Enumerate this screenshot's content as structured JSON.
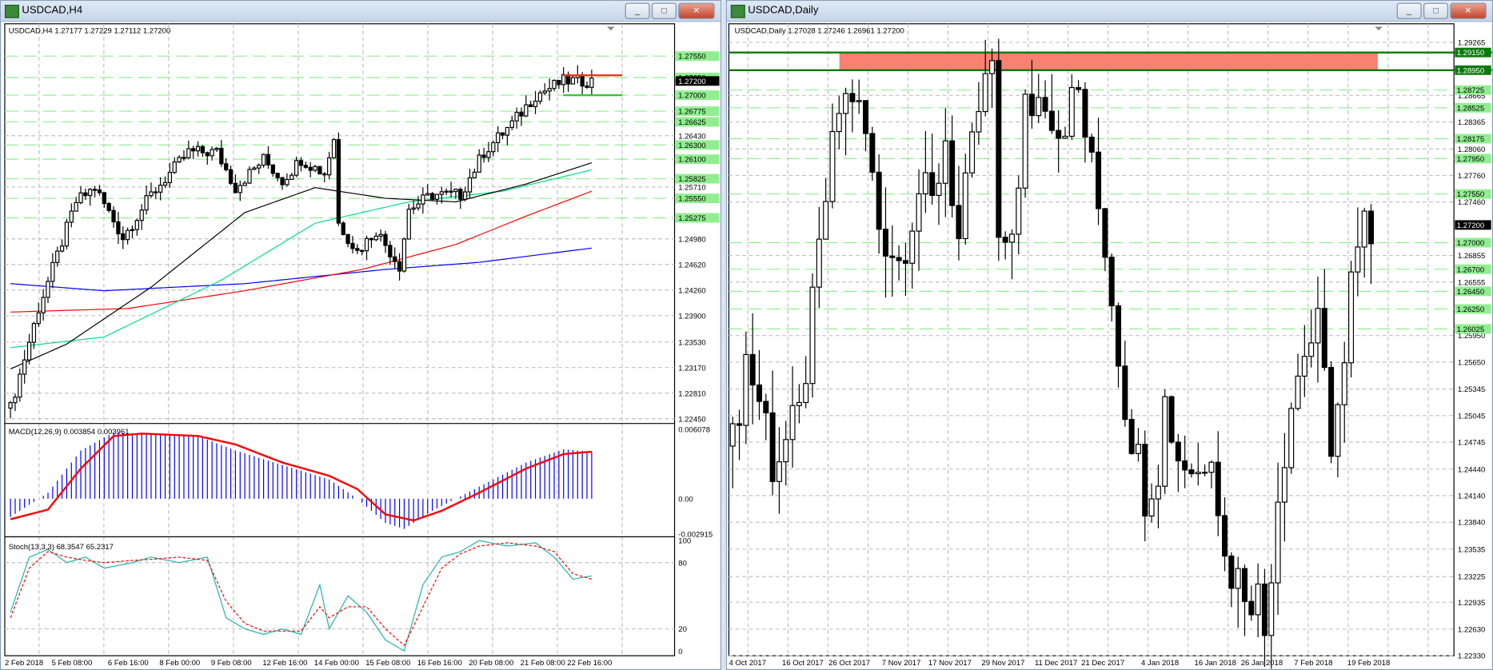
{
  "left": {
    "title": "USDCAD,H4",
    "info": "USDCAD,H4  1.27177 1.27229 1.27112 1.27200",
    "price_range": [
      1.2245,
      1.2775
    ],
    "candle_count": 125,
    "price_keys": [
      [
        0,
        1.226
      ],
      [
        6,
        1.24
      ],
      [
        14,
        1.255
      ],
      [
        18,
        1.257
      ],
      [
        24,
        1.25
      ],
      [
        30,
        1.256
      ],
      [
        38,
        1.262
      ],
      [
        44,
        1.262
      ],
      [
        48,
        1.257
      ],
      [
        54,
        1.261
      ],
      [
        58,
        1.258
      ],
      [
        62,
        1.261
      ],
      [
        67,
        1.259
      ],
      [
        69,
        1.264
      ],
      [
        70,
        1.252
      ],
      [
        74,
        1.248
      ],
      [
        78,
        1.251
      ],
      [
        83,
        1.246
      ],
      [
        85,
        1.254
      ],
      [
        90,
        1.256
      ],
      [
        96,
        1.256
      ],
      [
        101,
        1.262
      ],
      [
        107,
        1.266
      ],
      [
        112,
        1.27
      ],
      [
        118,
        1.272
      ],
      [
        124,
        1.272
      ]
    ],
    "ma_black": [
      [
        0,
        1.2315
      ],
      [
        12,
        1.235
      ],
      [
        30,
        1.243
      ],
      [
        50,
        1.2535
      ],
      [
        65,
        1.257
      ],
      [
        80,
        1.2555
      ],
      [
        95,
        1.255
      ],
      [
        110,
        1.2575
      ],
      [
        124,
        1.2605
      ]
    ],
    "ma_green": [
      [
        0,
        1.2345
      ],
      [
        20,
        1.236
      ],
      [
        45,
        1.244
      ],
      [
        65,
        1.252
      ],
      [
        85,
        1.255
      ],
      [
        105,
        1.2565
      ],
      [
        124,
        1.2595
      ]
    ],
    "ma_red": [
      [
        0,
        1.2395
      ],
      [
        25,
        1.24
      ],
      [
        50,
        1.2425
      ],
      [
        75,
        1.2455
      ],
      [
        95,
        1.249
      ],
      [
        110,
        1.253
      ],
      [
        124,
        1.2565
      ]
    ],
    "ma_blue": [
      [
        0,
        1.2435
      ],
      [
        20,
        1.2425
      ],
      [
        50,
        1.2435
      ],
      [
        80,
        1.2455
      ],
      [
        100,
        1.2465
      ],
      [
        124,
        1.2485
      ]
    ],
    "levels": [
      {
        "price": 1.2755,
        "label": "1.27550",
        "type": "green"
      },
      {
        "price": 1.2725,
        "label": "1.27250",
        "type": "green"
      },
      {
        "price": 1.27,
        "label": "1.27000",
        "type": "green"
      },
      {
        "price": 1.26775,
        "label": "1.26775",
        "type": "green"
      },
      {
        "price": 1.26625,
        "label": "1.26625",
        "type": "green"
      },
      {
        "price": 1.263,
        "label": "1.26300",
        "type": "green"
      },
      {
        "price": 1.261,
        "label": "1.26100",
        "type": "green"
      },
      {
        "price": 1.25825,
        "label": "1.25825",
        "type": "green"
      },
      {
        "price": 1.2555,
        "label": "1.25550",
        "type": "green"
      },
      {
        "price": 1.25275,
        "label": "1.25275",
        "type": "green"
      }
    ],
    "grid_labels": [
      "1.26430",
      "1.25710",
      "1.24980",
      "1.24620",
      "1.24260",
      "1.23900",
      "1.23530",
      "1.23170",
      "1.22810",
      "1.22450"
    ],
    "grid_prices": [
      1.2643,
      1.2571,
      1.2498,
      1.2462,
      1.2426,
      1.239,
      1.2353,
      1.2317,
      1.2281,
      1.2245
    ],
    "current_price": "1.27200",
    "resistance": {
      "price": 1.2728,
      "color": "#e8361a"
    },
    "support": {
      "price": 1.27,
      "color": "#32c832"
    },
    "macd": {
      "label": "MACD(12,26,9) 0.003854 0.003961",
      "max": "0.006078",
      "zero": "0.00",
      "min": "-0.002915",
      "range": [
        -0.002915,
        0.006078
      ],
      "hist_keys": [
        [
          0,
          -0.0015
        ],
        [
          8,
          0.0005
        ],
        [
          15,
          0.004
        ],
        [
          22,
          0.0055
        ],
        [
          28,
          0.0054
        ],
        [
          40,
          0.0052
        ],
        [
          48,
          0.004
        ],
        [
          58,
          0.0028
        ],
        [
          68,
          0.0016
        ],
        [
          74,
          0.0
        ],
        [
          80,
          -0.002
        ],
        [
          84,
          -0.0025
        ],
        [
          90,
          -0.001
        ],
        [
          100,
          0.001
        ],
        [
          110,
          0.003
        ],
        [
          118,
          0.0041
        ],
        [
          124,
          0.0039
        ]
      ],
      "signal_keys": [
        [
          0,
          -0.0017
        ],
        [
          8,
          -0.0009
        ],
        [
          15,
          0.0025
        ],
        [
          22,
          0.0052
        ],
        [
          28,
          0.0054
        ],
        [
          40,
          0.0052
        ],
        [
          48,
          0.0045
        ],
        [
          58,
          0.003
        ],
        [
          68,
          0.0019
        ],
        [
          74,
          0.0008
        ],
        [
          80,
          -0.0013
        ],
        [
          86,
          -0.0018
        ],
        [
          92,
          -0.001
        ],
        [
          100,
          0.0005
        ],
        [
          110,
          0.0025
        ],
        [
          118,
          0.0037
        ],
        [
          124,
          0.0039
        ]
      ]
    },
    "stoch": {
      "label": "Stoch(13,3,3) 68.3547 65.2317",
      "ticks": [
        "100",
        "80",
        "20",
        "0"
      ],
      "main_keys": [
        [
          0,
          35
        ],
        [
          4,
          85
        ],
        [
          8,
          92
        ],
        [
          12,
          80
        ],
        [
          16,
          85
        ],
        [
          20,
          75
        ],
        [
          26,
          80
        ],
        [
          30,
          85
        ],
        [
          36,
          80
        ],
        [
          42,
          85
        ],
        [
          46,
          30
        ],
        [
          50,
          20
        ],
        [
          54,
          15
        ],
        [
          58,
          20
        ],
        [
          62,
          15
        ],
        [
          66,
          60
        ],
        [
          68,
          20
        ],
        [
          72,
          50
        ],
        [
          76,
          35
        ],
        [
          80,
          10
        ],
        [
          84,
          0
        ],
        [
          88,
          60
        ],
        [
          92,
          85
        ],
        [
          96,
          90
        ],
        [
          100,
          100
        ],
        [
          106,
          95
        ],
        [
          112,
          98
        ],
        [
          116,
          85
        ],
        [
          120,
          65
        ],
        [
          124,
          68
        ]
      ],
      "signal_keys": [
        [
          0,
          30
        ],
        [
          4,
          75
        ],
        [
          8,
          90
        ],
        [
          12,
          85
        ],
        [
          16,
          82
        ],
        [
          20,
          80
        ],
        [
          26,
          82
        ],
        [
          30,
          83
        ],
        [
          36,
          85
        ],
        [
          42,
          82
        ],
        [
          46,
          45
        ],
        [
          50,
          25
        ],
        [
          54,
          18
        ],
        [
          58,
          18
        ],
        [
          62,
          18
        ],
        [
          66,
          40
        ],
        [
          68,
          30
        ],
        [
          72,
          40
        ],
        [
          76,
          40
        ],
        [
          80,
          20
        ],
        [
          84,
          5
        ],
        [
          88,
          40
        ],
        [
          92,
          75
        ],
        [
          96,
          88
        ],
        [
          100,
          95
        ],
        [
          106,
          98
        ],
        [
          112,
          95
        ],
        [
          116,
          90
        ],
        [
          120,
          70
        ],
        [
          124,
          65
        ]
      ]
    },
    "time_labels": [
      [
        0,
        "2 Feb 2018"
      ],
      [
        10,
        "5 Feb 08:00"
      ],
      [
        22,
        "6 Feb 16:00"
      ],
      [
        33,
        "8 Feb 00:00"
      ],
      [
        44,
        "9 Feb 08:00"
      ],
      [
        55,
        "12 Feb 16:00"
      ],
      [
        66,
        "14 Feb 00:00"
      ],
      [
        77,
        "15 Feb 08:00"
      ],
      [
        88,
        "16 Feb 16:00"
      ],
      [
        99,
        "20 Feb 08:00"
      ],
      [
        110,
        "21 Feb 08:00"
      ],
      [
        120,
        "22 Feb 16:00"
      ]
    ]
  },
  "right": {
    "title": "USDCAD,Daily",
    "info": "USDCAD,Daily  1.27028 1.27246 1.26961 1.27200",
    "price_range": [
      1.2233,
      1.2927
    ],
    "candle_count": 97,
    "price_keys": [
      [
        0,
        1.247
      ],
      [
        2,
        1.257
      ],
      [
        5,
        1.25
      ],
      [
        6,
        1.245
      ],
      [
        10,
        1.25
      ],
      [
        12,
        1.262
      ],
      [
        14,
        1.275
      ],
      [
        16,
        1.285
      ],
      [
        18,
        1.287
      ],
      [
        20,
        1.282
      ],
      [
        22,
        1.272
      ],
      [
        25,
        1.268
      ],
      [
        28,
        1.276
      ],
      [
        30,
        1.274
      ],
      [
        32,
        1.282
      ],
      [
        34,
        1.27
      ],
      [
        37,
        1.285
      ],
      [
        39,
        1.29
      ],
      [
        40,
        1.268
      ],
      [
        43,
        1.275
      ],
      [
        44,
        1.285
      ],
      [
        47,
        1.287
      ],
      [
        49,
        1.283
      ],
      [
        52,
        1.287
      ],
      [
        54,
        1.278
      ],
      [
        56,
        1.27
      ],
      [
        58,
        1.258
      ],
      [
        59,
        1.252
      ],
      [
        62,
        1.242
      ],
      [
        64,
        1.245
      ],
      [
        65,
        1.252
      ],
      [
        67,
        1.246
      ],
      [
        70,
        1.244
      ],
      [
        72,
        1.248
      ],
      [
        74,
        1.234
      ],
      [
        76,
        1.232
      ],
      [
        79,
        1.23
      ],
      [
        80,
        1.226
      ],
      [
        82,
        1.242
      ],
      [
        84,
        1.252
      ],
      [
        86,
        1.258
      ],
      [
        88,
        1.26
      ],
      [
        90,
        1.248
      ],
      [
        92,
        1.255
      ],
      [
        93,
        1.265
      ],
      [
        95,
        1.271
      ],
      [
        96,
        1.272
      ]
    ],
    "zone": {
      "top": 1.2915,
      "bottom": 1.2895,
      "top_label": "1.29150",
      "bottom_label": "1.28950",
      "fill": "#fa8072",
      "line": "#0a7a0a"
    },
    "levels": [
      {
        "price": 1.28725,
        "label": "1.28725"
      },
      {
        "price": 1.28525,
        "label": "1.28525"
      },
      {
        "price": 1.28175,
        "label": "1.28175"
      },
      {
        "price": 1.2795,
        "label": "1.27950"
      },
      {
        "price": 1.2755,
        "label": "1.27550"
      },
      {
        "price": 1.27,
        "label": "1.27000"
      },
      {
        "price": 1.267,
        "label": "1.26700"
      },
      {
        "price": 1.2645,
        "label": "1.26450"
      },
      {
        "price": 1.2625,
        "label": "1.26250"
      },
      {
        "price": 1.26025,
        "label": "1.26025"
      }
    ],
    "grid_labels": [
      "1.29265",
      "1.28665",
      "1.28365",
      "1.28060",
      "1.27760",
      "1.27460",
      "1.26855",
      "1.26555",
      "1.25950",
      "1.25650",
      "1.25345",
      "1.25045",
      "1.24745",
      "1.24440",
      "1.24140",
      "1.23840",
      "1.23535",
      "1.23225",
      "1.22935",
      "1.22630",
      "1.22330"
    ],
    "grid_prices": [
      1.29265,
      1.28665,
      1.28365,
      1.2806,
      1.2776,
      1.2746,
      1.26855,
      1.26555,
      1.2595,
      1.2565,
      1.25345,
      1.25045,
      1.24745,
      1.2444,
      1.2414,
      1.2384,
      1.23535,
      1.23225,
      1.22935,
      1.2263,
      1.2233
    ],
    "current_price": "1.27200",
    "time_labels": [
      [
        0,
        "4 Oct 2017"
      ],
      [
        8,
        "16 Oct 2017"
      ],
      [
        15,
        "26 Oct 2017"
      ],
      [
        23,
        "7 Nov 2017"
      ],
      [
        30,
        "17 Nov 2017"
      ],
      [
        38,
        "29 Nov 2017"
      ],
      [
        46,
        "11 Dec 2017"
      ],
      [
        53,
        "21 Dec 2017"
      ],
      [
        62,
        "4 Jan 2018"
      ],
      [
        70,
        "16 Jan 2018"
      ],
      [
        77,
        "26 Jan 2018"
      ],
      [
        85,
        "7 Feb 2018"
      ],
      [
        93,
        "19 Feb 2018"
      ]
    ]
  },
  "buttons": {
    "min": "_",
    "max": "□",
    "close": "✕"
  }
}
